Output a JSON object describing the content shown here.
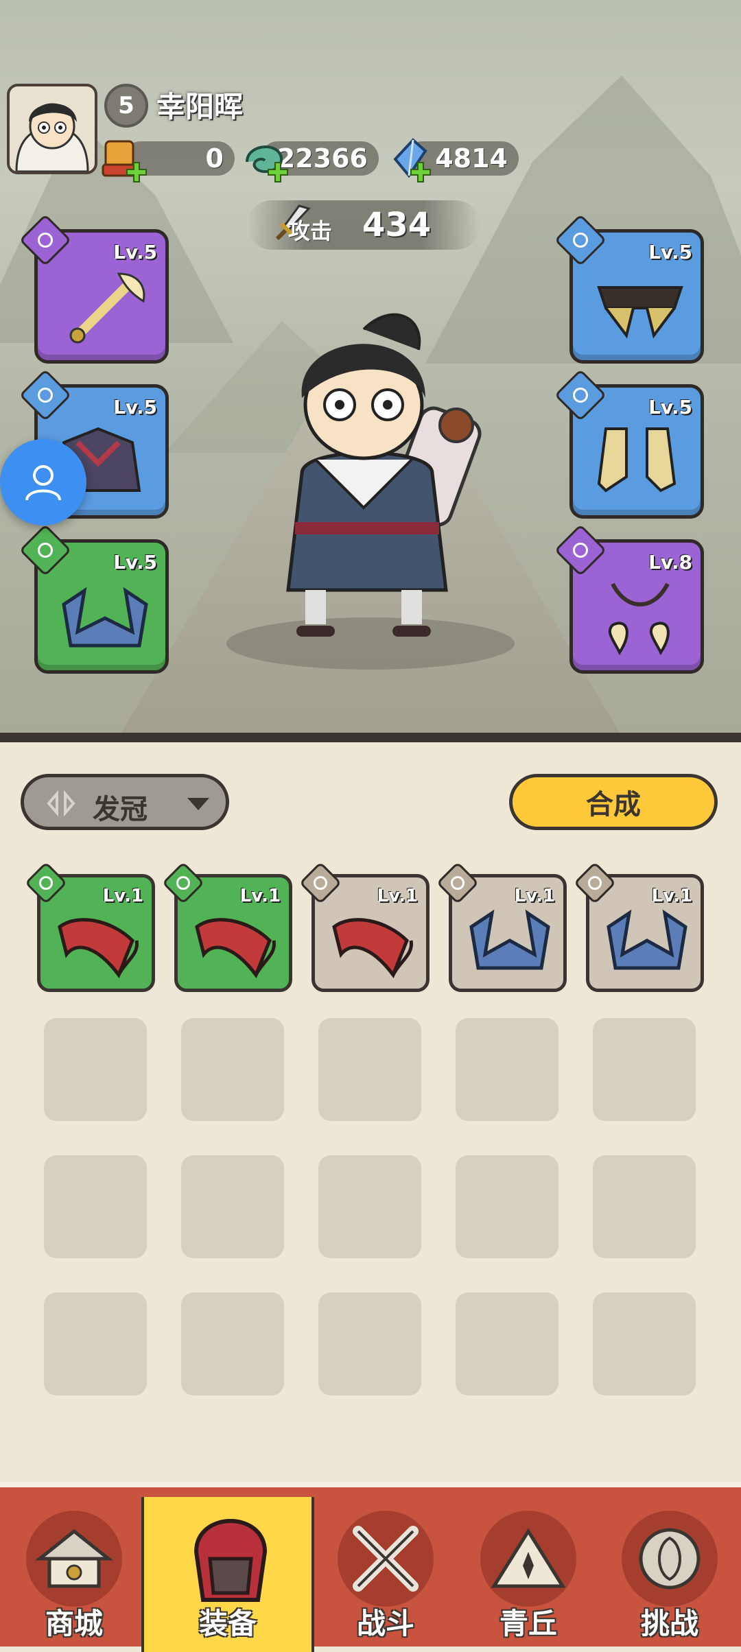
{
  "player": {
    "level": "5",
    "name": "幸阳晖"
  },
  "resources": [
    {
      "name": "scroll-currency",
      "value": "0"
    },
    {
      "name": "jade-currency",
      "value": "22366"
    },
    {
      "name": "crystal-currency",
      "value": "4814"
    }
  ],
  "attack": {
    "label": "攻击",
    "value": "434"
  },
  "equipped": {
    "left": [
      {
        "slot": "weapon",
        "level": "Lv.5",
        "rarity": "purple"
      },
      {
        "slot": "armor",
        "level": "Lv.5",
        "rarity": "blue"
      },
      {
        "slot": "headgear",
        "level": "Lv.5",
        "rarity": "green"
      }
    ],
    "right": [
      {
        "slot": "belt",
        "level": "Lv.5",
        "rarity": "blue"
      },
      {
        "slot": "boots",
        "level": "Lv.5",
        "rarity": "blue"
      },
      {
        "slot": "accessory",
        "level": "Lv.8",
        "rarity": "purple"
      }
    ]
  },
  "filter": {
    "label": "发冠"
  },
  "compose_button": "合成",
  "bag": [
    {
      "level": "Lv.1",
      "rarity": "green",
      "item": "red-crown"
    },
    {
      "level": "Lv.1",
      "rarity": "green",
      "item": "red-crown"
    },
    {
      "level": "Lv.1",
      "rarity": "gray",
      "item": "red-crown"
    },
    {
      "level": "Lv.1",
      "rarity": "gray",
      "item": "blue-crown"
    },
    {
      "level": "Lv.1",
      "rarity": "gray",
      "item": "blue-crown"
    }
  ],
  "nav": [
    {
      "label": "商城",
      "icon": "shop-icon"
    },
    {
      "label": "装备",
      "icon": "equipment-icon",
      "active": true
    },
    {
      "label": "战斗",
      "icon": "battle-icon"
    },
    {
      "label": "青丘",
      "icon": "qingqiu-icon"
    },
    {
      "label": "挑战",
      "icon": "challenge-icon"
    }
  ],
  "colors": {
    "purple": "#9b63d3",
    "blue": "#5b9be0",
    "green": "#52b356",
    "gray": "#cfc6b8",
    "accent": "#ffc93a",
    "nav": "#c8533f"
  }
}
